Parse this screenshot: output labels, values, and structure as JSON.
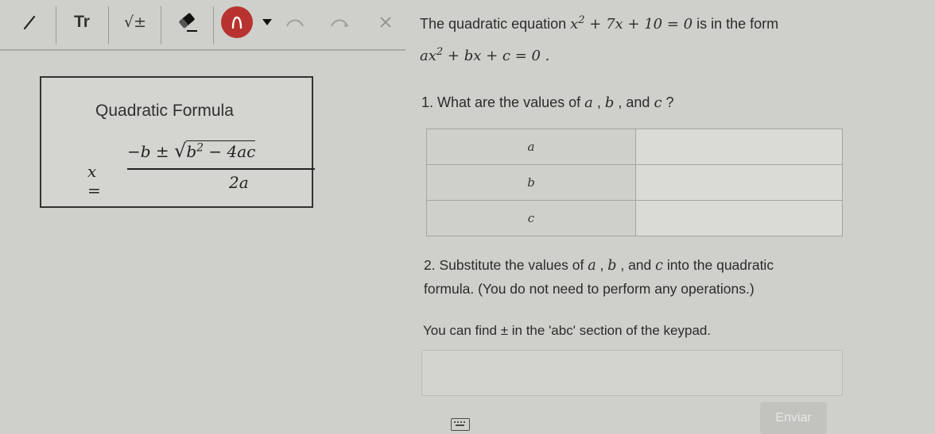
{
  "toolbar": {
    "tools": [
      "pencil-tool",
      "text-tool",
      "math-tool",
      "eraser-tool",
      "lasso-tool"
    ],
    "text_tool_label": "Tr",
    "math_tool_label": "√±"
  },
  "formula_box": {
    "title": "Quadratic Formula",
    "lhs": "x =",
    "numerator_prefix": "−b ± ",
    "radicand_base": "b",
    "radicand_exponent": "2",
    "radicand_rest": " − 4ac",
    "denominator": "2a"
  },
  "problem": {
    "intro_prefix": "The quadratic equation ",
    "equation_base": "x",
    "equation_exponent": "2",
    "equation_rest": " + 7x + 10 = 0",
    "intro_suffix": " is in the form",
    "form_base": "ax",
    "form_exponent": "2",
    "form_rest": " + bx + c = 0 ."
  },
  "question1": {
    "prefix": "1. What are the values of ",
    "a": "a",
    "sep1": " , ",
    "b": "b",
    "sep2": " , and ",
    "c": "c",
    "suffix": " ?"
  },
  "table": {
    "rows": [
      {
        "label": "a",
        "value": ""
      },
      {
        "label": "b",
        "value": ""
      },
      {
        "label": "c",
        "value": ""
      }
    ]
  },
  "question2": {
    "prefix": "2. Substitute the values of ",
    "a": "a",
    "sep1": " , ",
    "b": "b",
    "sep2": " , and ",
    "c": "c",
    "line1_suffix": " into the quadratic",
    "line2": "formula. (You do not need to perform any operations.)"
  },
  "hint": {
    "prefix": "You can find ",
    "symbol": "±",
    "suffix": " in the 'abc' section of the keypad."
  },
  "answer": {
    "value": ""
  },
  "submit_label": "Enviar",
  "colors": {
    "lasso_active": "#b8332f",
    "background": "#cfd0cb"
  }
}
